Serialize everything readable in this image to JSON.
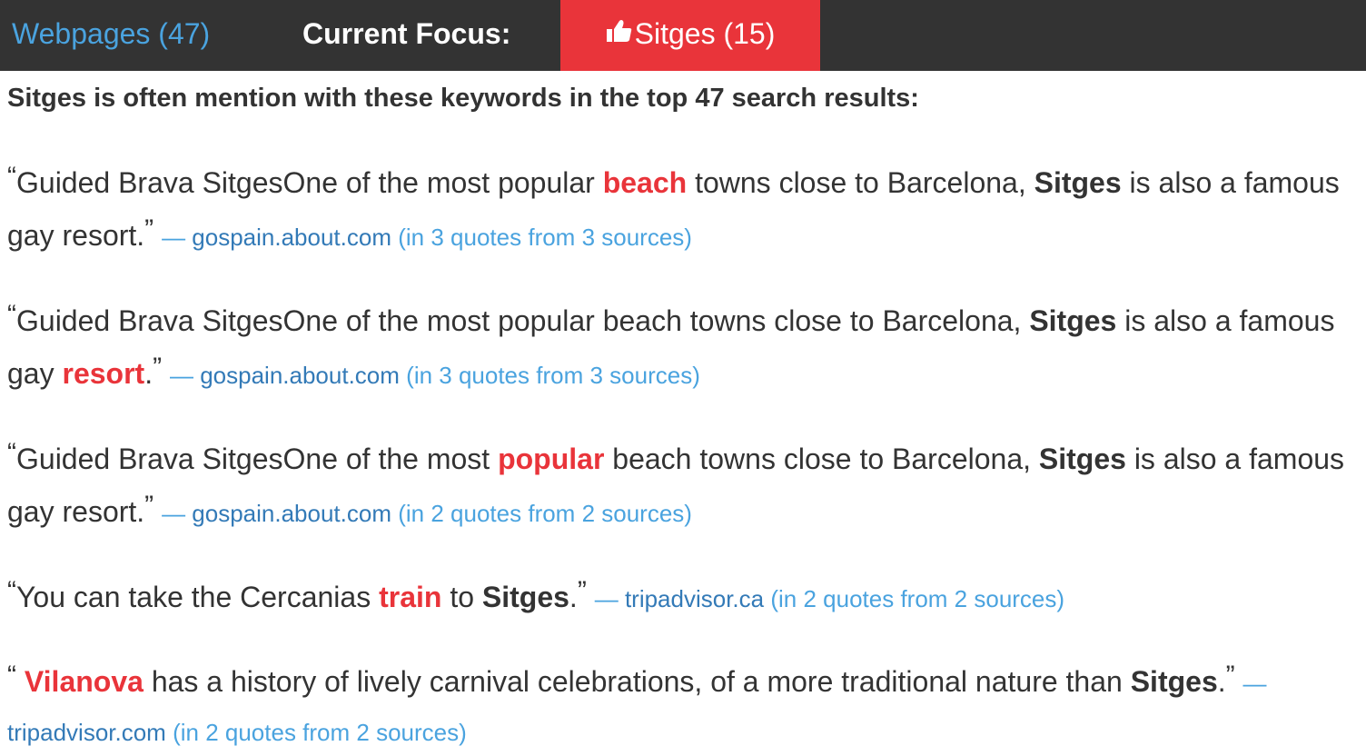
{
  "nav": {
    "webpages_label": "Webpages (47)",
    "focus_label": "Current Focus:",
    "focus_value": "Sitges (15)",
    "focus_icon": "thumbs-up-icon",
    "colors": {
      "bar_bg": "#333333",
      "focus_bg": "#e9343a",
      "link": "#4aa3df",
      "keyword": "#e9343a"
    }
  },
  "heading": "Sitges is often mention with these keywords in the top 47 search results:",
  "quotes": [
    {
      "parts": [
        "Guided Brava SitgesOne of the most popular ",
        "beach",
        " towns close to Barcelona, ",
        "Sitges",
        " is also a famous gay resort."
      ],
      "open_mark": "“",
      "close_mark": "”",
      "dash": "—",
      "domain": "gospain.about.com",
      "count": "(in 3 quotes from 3 sources)"
    },
    {
      "parts": [
        "Guided Brava SitgesOne of the most popular beach towns close to Barcelona, ",
        "Sitges",
        " is also a famous gay ",
        "resort",
        "."
      ],
      "open_mark": "“",
      "close_mark": "”",
      "dash": "—",
      "domain": "gospain.about.com",
      "count": "(in 3 quotes from 3 sources)"
    },
    {
      "parts": [
        "Guided Brava SitgesOne of the most ",
        "popular",
        " beach towns close to Barcelona, ",
        "Sitges",
        " is also a famous gay resort."
      ],
      "open_mark": "“",
      "close_mark": "”",
      "dash": "—",
      "domain": "gospain.about.com",
      "count": "(in 2 quotes from 2 sources)"
    },
    {
      "parts": [
        "You can take the Cercanias ",
        "train",
        " to ",
        "Sitges",
        "."
      ],
      "open_mark": "“",
      "close_mark": "”",
      "dash": "—",
      "domain": "tripadvisor.ca",
      "count": "(in 2 quotes from 2 sources)"
    },
    {
      "parts": [
        " ",
        "Vilanova",
        " has a history of lively carnival celebrations, of a more traditional nature than ",
        "Sitges",
        "."
      ],
      "open_mark": "“",
      "close_mark": "”",
      "dash": "—",
      "domain": "tripadvisor.com",
      "count": "(in 2 quotes from 2 sources)"
    }
  ]
}
